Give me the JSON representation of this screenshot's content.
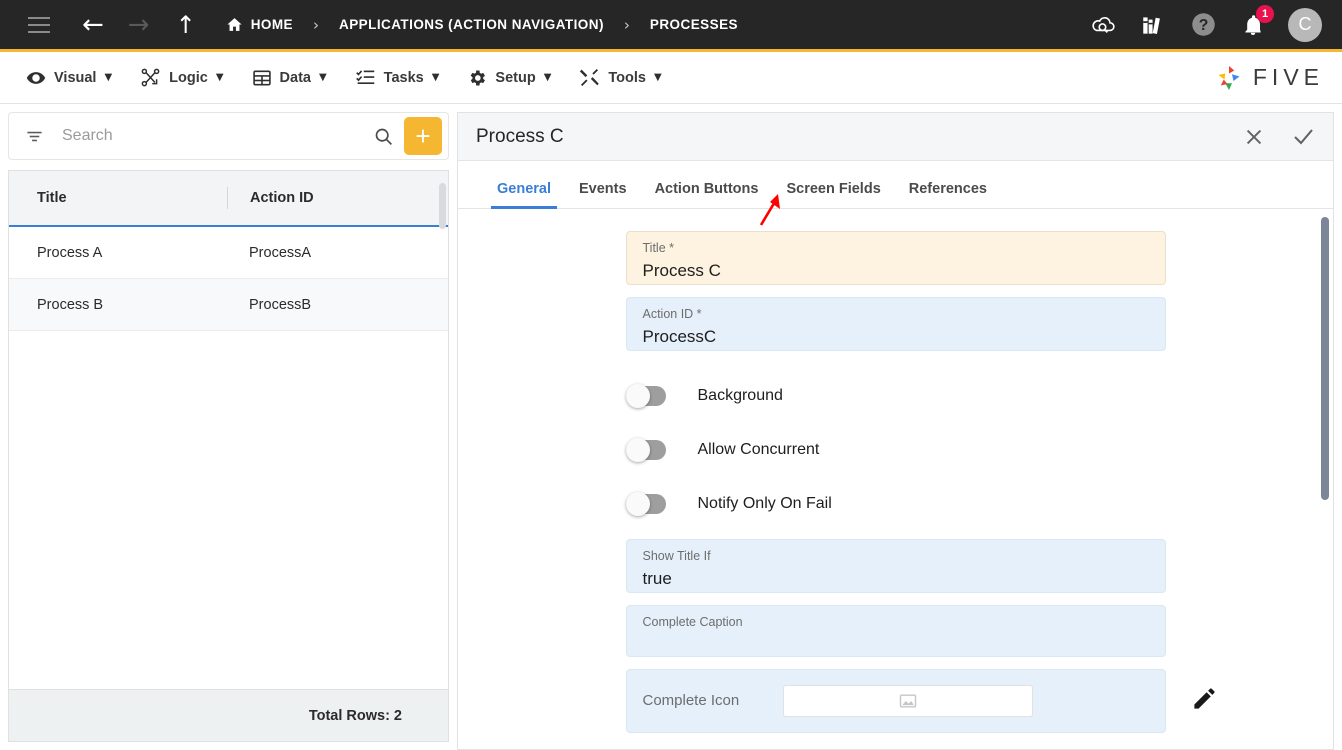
{
  "topbar": {
    "menu_icon": "hamburger-menu-icon",
    "back_icon": "back-arrow-icon",
    "forward_icon": "forward-arrow-icon",
    "up_icon": "up-arrow-icon",
    "breadcrumbs": [
      {
        "label": "HOME",
        "icon": "home-icon"
      },
      {
        "label": "APPLICATIONS (ACTION NAVIGATION)",
        "icon": ""
      },
      {
        "label": "PROCESSES",
        "icon": ""
      }
    ],
    "separator": "›",
    "actions": [
      {
        "name": "cloud-search-icon"
      },
      {
        "name": "library-books-icon"
      },
      {
        "name": "help-icon"
      },
      {
        "name": "notifications-bell-icon",
        "badge": "1"
      }
    ],
    "avatar_initial": "C",
    "accent_color": "#f5b731",
    "badge_color": "#e8124f"
  },
  "menubar": {
    "items": [
      {
        "label": "Visual",
        "icon": "eye-icon",
        "caret": "▼"
      },
      {
        "label": "Logic",
        "icon": "logic-nodes-icon",
        "caret": "▼"
      },
      {
        "label": "Data",
        "icon": "table-grid-icon",
        "caret": "▼"
      },
      {
        "label": "Tasks",
        "icon": "checklist-icon",
        "caret": "▼"
      },
      {
        "label": "Setup",
        "icon": "gear-icon",
        "caret": "▼"
      },
      {
        "label": "Tools",
        "icon": "tools-wrench-icon",
        "caret": "▼"
      }
    ],
    "brand": {
      "text": "FIVE",
      "icon": "five-pinwheel-logo"
    }
  },
  "left_panel": {
    "search": {
      "placeholder": "Search",
      "value": "",
      "filter_icon": "filter-icon",
      "search_icon": "search-icon"
    },
    "add_button_label": "+",
    "columns": [
      "Title",
      "Action ID"
    ],
    "rows": [
      {
        "title": "Process A",
        "action_id": "ProcessA"
      },
      {
        "title": "Process B",
        "action_id": "ProcessB"
      }
    ],
    "footer": "Total Rows: 2"
  },
  "right_panel": {
    "title": "Process C",
    "close_icon": "close-x-icon",
    "confirm_icon": "check-tick-icon",
    "tabs": [
      {
        "label": "General",
        "active": true
      },
      {
        "label": "Events",
        "active": false
      },
      {
        "label": "Action Buttons",
        "active": false
      },
      {
        "label": "Screen Fields",
        "active": false
      },
      {
        "label": "References",
        "active": false
      }
    ],
    "accent_color": "#3a7fd5",
    "form": {
      "title_field": {
        "label": "Title *",
        "value": "Process C"
      },
      "action_id_field": {
        "label": "Action ID *",
        "value": "ProcessC"
      },
      "toggles": [
        {
          "label": "Background",
          "on": false
        },
        {
          "label": "Allow Concurrent",
          "on": false
        },
        {
          "label": "Notify Only On Fail",
          "on": false
        }
      ],
      "show_title_if": {
        "label": "Show Title If",
        "value": "true"
      },
      "complete_caption": {
        "label": "Complete Caption",
        "value": ""
      },
      "complete_icon": {
        "label": "Complete Icon",
        "value": "",
        "placeholder_icon": "image-placeholder-icon",
        "edit_icon": "pencil-edit-icon"
      }
    }
  },
  "annotation": {
    "type": "red-arrow",
    "points_to": "Screen Fields",
    "color": "#ff0000"
  }
}
